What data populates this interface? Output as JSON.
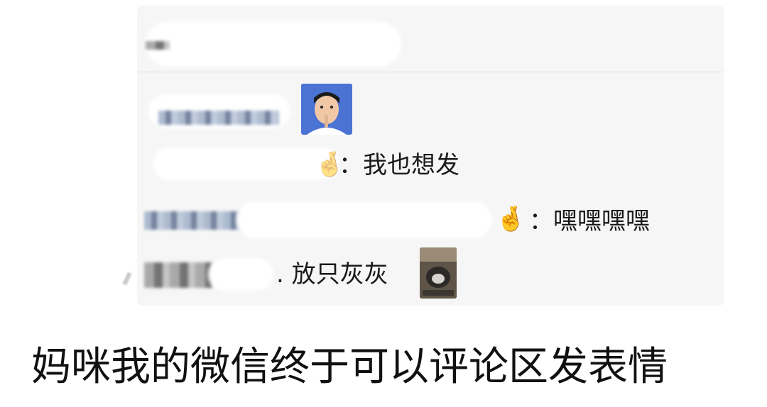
{
  "comments": [
    {
      "text": "：我也想发"
    },
    {
      "text": "：嘿嘿嘿嘿"
    },
    {
      "text": ". 放只灰灰"
    }
  ],
  "emojis": {
    "hand_small": "🤞",
    "hand_large": "🤞"
  },
  "post": {
    "headline": "妈咪我的微信终于可以评论区发表情"
  }
}
